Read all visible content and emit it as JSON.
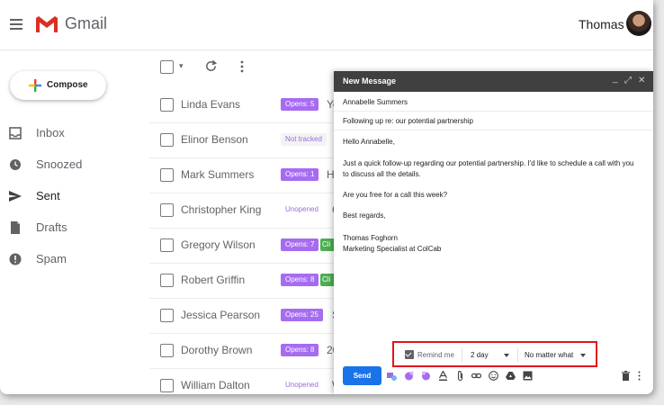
{
  "header": {
    "brand": "Gmail",
    "user_name": "Thomas"
  },
  "sidebar": {
    "compose_label": "Compose",
    "items": [
      {
        "label": "Inbox",
        "icon": "inbox-icon"
      },
      {
        "label": "Snoozed",
        "icon": "clock-icon"
      },
      {
        "label": "Sent",
        "icon": "send-icon"
      },
      {
        "label": "Drafts",
        "icon": "draft-icon"
      },
      {
        "label": "Spam",
        "icon": "spam-icon"
      }
    ]
  },
  "email_list": [
    {
      "sender": "Linda Evans",
      "badge": "Opens: 5",
      "badge_style": "purple",
      "trunc": "Yo"
    },
    {
      "sender": "Elinor Benson",
      "badge": "Not tracked",
      "badge_style": "gray",
      "trunc": ""
    },
    {
      "sender": "Mark Summers",
      "badge": "Opens: 1",
      "badge_style": "purple",
      "trunc": "H"
    },
    {
      "sender": "Christopher King",
      "badge": "Unopened",
      "badge_style": "white",
      "trunc": "C"
    },
    {
      "sender": "Gregory Wilson",
      "badge": "Opens: 7",
      "badge_style": "purple",
      "extra": "Cli"
    },
    {
      "sender": "Robert Griffin",
      "badge": "Opens: 8",
      "badge_style": "purple",
      "extra": "Cli"
    },
    {
      "sender": "Jessica Pearson",
      "badge": "Opens: 25",
      "badge_style": "purple",
      "trunc": "S"
    },
    {
      "sender": "Dorothy Brown",
      "badge": "Opens: 8",
      "badge_style": "purple",
      "trunc": "20"
    },
    {
      "sender": "William Dalton",
      "badge": "Unopened",
      "badge_style": "white",
      "trunc": "W"
    }
  ],
  "compose": {
    "title": "New Message",
    "to": "Annabelle Summers",
    "subject": "Following up re: our potential partnership",
    "body_greeting": "Hello Annabelle,",
    "body_line1": "Just a quick follow-up regarding our potential partnership. I'd like to schedule a call with you",
    "body_line2": "to discuss all the details.",
    "body_question": "Are you free for a call this week?",
    "body_signoff": "Best regards,",
    "sig_name": "Thomas Foghorn",
    "sig_title": "Marketing Specialist at ColCab",
    "reminder_label": "Remind me",
    "reminder_delay": "2 day",
    "reminder_condition": "No matter what",
    "send_label": "Send"
  },
  "colors": {
    "accent": "#1a73e8",
    "highlight_border": "#e1141d",
    "badge_purple": "#a66cf0",
    "compose_header": "#404040"
  }
}
